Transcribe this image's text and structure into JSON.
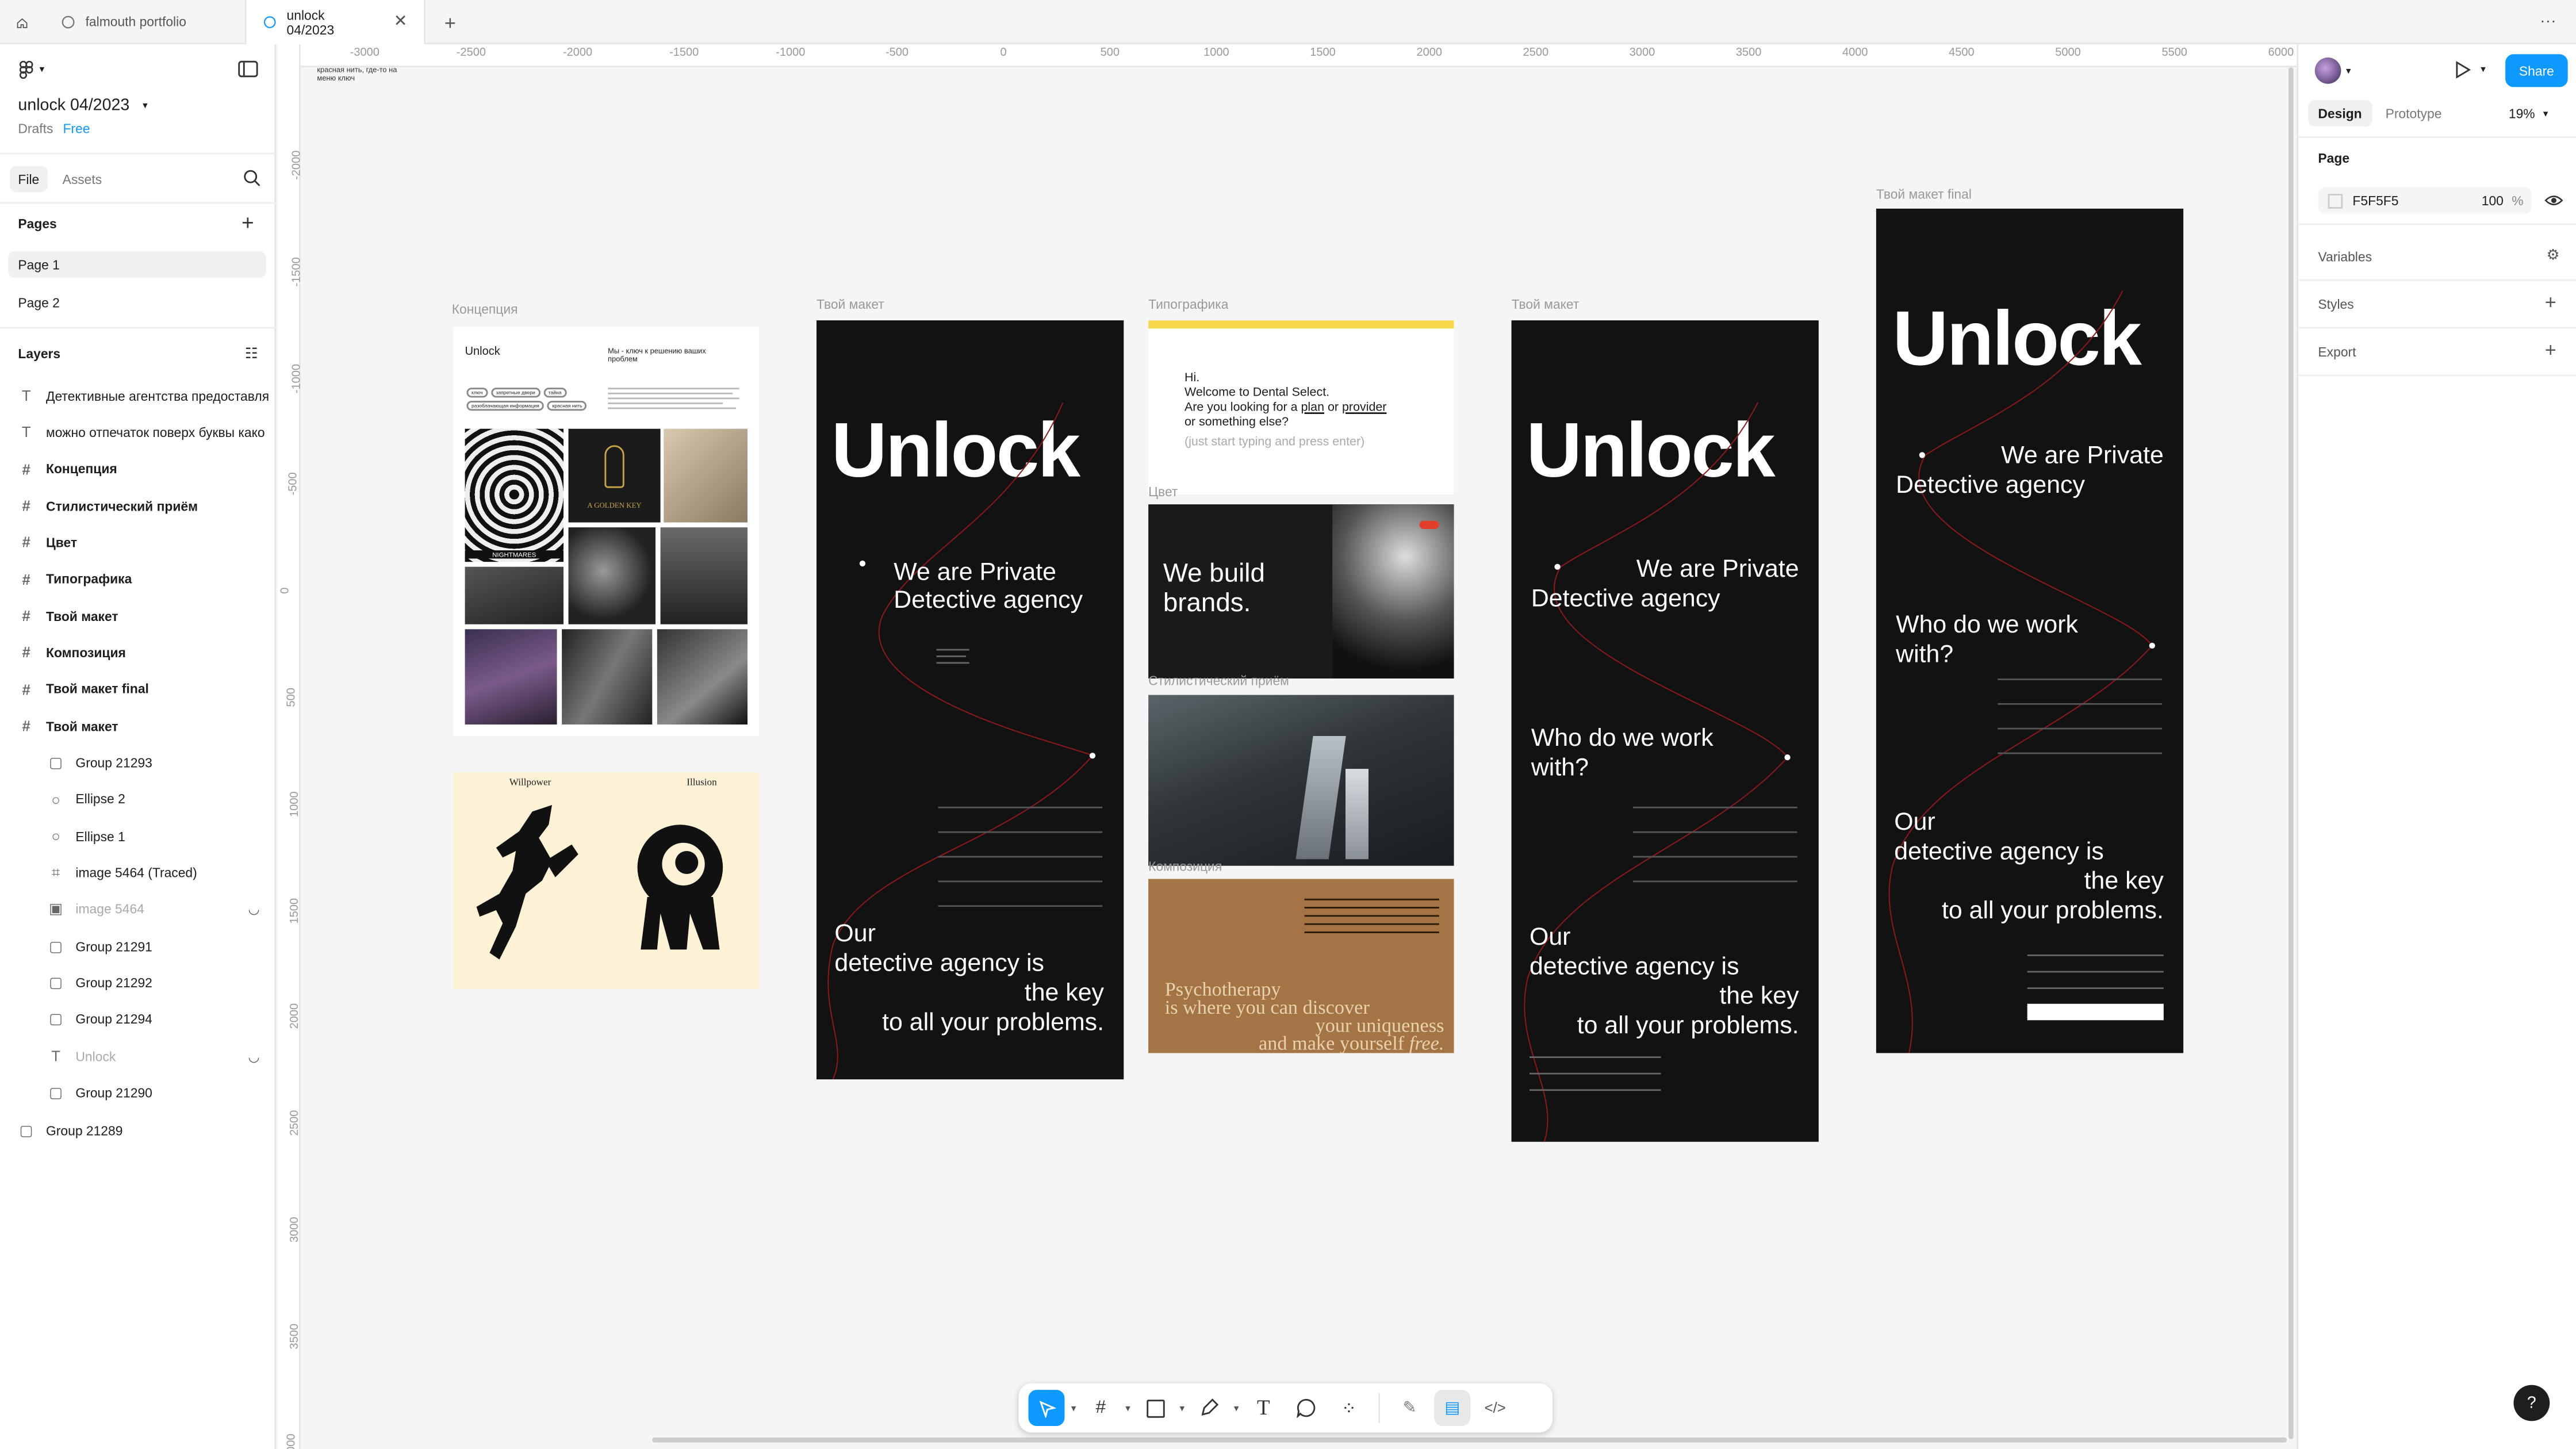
{
  "tabs": {
    "home_icon": "home-icon",
    "items": [
      {
        "label": "falmouth portfolio",
        "active": false
      },
      {
        "label": "unlock 04/2023",
        "active": true
      }
    ],
    "new_tab": "+",
    "menu": "···"
  },
  "file": {
    "name": "unlock 04/2023",
    "location": "Drafts",
    "plan": "Free",
    "tab_file": "File",
    "tab_assets": "Assets"
  },
  "pages": {
    "title": "Pages",
    "items": [
      "Page 1",
      "Page 2"
    ]
  },
  "layers": {
    "title": "Layers",
    "items": [
      {
        "label": "Детективные агентства предоставля",
        "icon": "text-icon",
        "bold": false,
        "indent": 0,
        "hidden": false
      },
      {
        "label": "можно отпечаток поверх буквы како",
        "icon": "text-icon",
        "bold": false,
        "indent": 0,
        "hidden": false
      },
      {
        "label": "Концепция",
        "icon": "frame-icon",
        "bold": true,
        "indent": 0,
        "hidden": false
      },
      {
        "label": "Стилистический приём",
        "icon": "frame-icon",
        "bold": true,
        "indent": 0,
        "hidden": false
      },
      {
        "label": "Цвет",
        "icon": "frame-icon",
        "bold": true,
        "indent": 0,
        "hidden": false
      },
      {
        "label": "Типографика",
        "icon": "frame-icon",
        "bold": true,
        "indent": 0,
        "hidden": false
      },
      {
        "label": "Твой макет",
        "icon": "frame-icon",
        "bold": true,
        "indent": 0,
        "hidden": false
      },
      {
        "label": "Композиция",
        "icon": "frame-icon",
        "bold": true,
        "indent": 0,
        "hidden": false
      },
      {
        "label": "Твой макет final",
        "icon": "frame-icon",
        "bold": true,
        "indent": 0,
        "hidden": false
      },
      {
        "label": "Твой макет",
        "icon": "frame-icon",
        "bold": true,
        "indent": 0,
        "hidden": false
      },
      {
        "label": "Group 21293",
        "icon": "group-icon",
        "bold": false,
        "indent": 1,
        "hidden": false
      },
      {
        "label": "Ellipse 2",
        "icon": "ellipse-icon",
        "bold": false,
        "indent": 1,
        "hidden": false
      },
      {
        "label": "Ellipse 1",
        "icon": "ellipse-icon",
        "bold": false,
        "indent": 1,
        "hidden": false
      },
      {
        "label": "image 5464 (Traced)",
        "icon": "vector-icon",
        "bold": false,
        "indent": 1,
        "hidden": false
      },
      {
        "label": "image 5464",
        "icon": "image-icon",
        "bold": false,
        "indent": 1,
        "hidden": true
      },
      {
        "label": "Group 21291",
        "icon": "group-icon",
        "bold": false,
        "indent": 1,
        "hidden": false
      },
      {
        "label": "Group 21292",
        "icon": "group-icon",
        "bold": false,
        "indent": 1,
        "hidden": false
      },
      {
        "label": "Group 21294",
        "icon": "group-icon",
        "bold": false,
        "indent": 1,
        "hidden": false
      },
      {
        "label": "Unlock",
        "icon": "text-icon",
        "bold": false,
        "indent": 1,
        "hidden": true
      },
      {
        "label": "Group 21290",
        "icon": "group-icon",
        "bold": false,
        "indent": 1,
        "hidden": false
      },
      {
        "label": "Group 21289",
        "icon": "group-icon",
        "bold": false,
        "indent": 0,
        "hidden": false
      }
    ]
  },
  "right": {
    "share": "Share",
    "tab_design": "Design",
    "tab_prototype": "Prototype",
    "zoom": "19%",
    "page_title": "Page",
    "page_color": "F5F5F5",
    "page_opacity": "100",
    "percent": "%",
    "variables": "Variables",
    "styles": "Styles",
    "export": "Export"
  },
  "canvas": {
    "ruler_x": [
      "-3000",
      "-2500",
      "-2000",
      "-1500",
      "-1000",
      "-500",
      "0",
      "500",
      "1000",
      "1500",
      "2000",
      "2500",
      "3000",
      "3500",
      "4000",
      "4500",
      "5000",
      "5500",
      "6000"
    ],
    "ruler_y": [
      "-2000",
      "-1500",
      "-1000",
      "-500",
      "0",
      "500",
      "1000",
      "1500",
      "2000",
      "2500",
      "3000",
      "3500",
      "000"
    ],
    "note_top": "красная нить, где-то на меню ключ",
    "labels": {
      "concept": "Концепция",
      "layout1": "Твой макет",
      "typo": "Типографика",
      "color": "Цвет",
      "style": "Стилистический приём",
      "composition": "Композиция",
      "layout2": "Твой макет",
      "final": "Твой макет final"
    },
    "concept": {
      "brand": "Unlock",
      "tagline": "Мы - ключ к решению ваших проблем",
      "chips": [
        "ключ",
        "запретные двери",
        "тайна",
        "разоблачающая информация",
        "красная нить"
      ],
      "book_title": "A GOLDEN KEY",
      "poster": "NIGHTMARES"
    },
    "willpower": {
      "left": "Willpower",
      "right": "Illusion"
    },
    "unlock": {
      "logo": "Unlock",
      "hero1": "We are Private",
      "hero2": "Detective agency",
      "who1": "Who do we work",
      "who2": "with?",
      "key1": "Our",
      "key2": "detective agency is",
      "key3": "the key",
      "key4": "to all your problems."
    },
    "typo": {
      "banner": "Hi.",
      "line1": "Welcome to Dental Select.",
      "line2a": "Are you looking for a ",
      "plan": "plan",
      "or": " or ",
      "provider": "provider",
      "line3": "or something else?",
      "hint": "(just start typing and press enter)"
    },
    "color": {
      "text1": "We build",
      "text2": "brands."
    },
    "composition": {
      "line1": "Psychotherapy",
      "line2": "is where you can discover",
      "line3": "your uniqueness",
      "line4": "and make yourself",
      "free": "free."
    }
  },
  "toolbar": {
    "tools": [
      "move-icon",
      "frame-tool-icon",
      "rectangle-icon",
      "pen-icon",
      "text-tool-icon",
      "comment-icon",
      "components-icon"
    ],
    "modes": [
      "draw-icon",
      "design-mode-icon",
      "dev-mode-icon"
    ]
  },
  "help": "?",
  "colors": {
    "accent": "#0d99ff",
    "dark_frame": "#121212",
    "red_thread": "#8b1a1a",
    "cream": "#fdf0d0",
    "brown": "#a47444"
  }
}
